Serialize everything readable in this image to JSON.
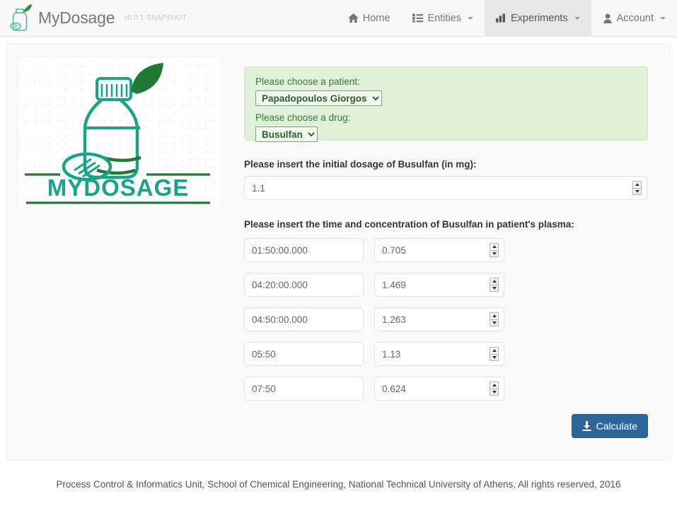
{
  "navbar": {
    "brand_name": "MyDosage",
    "brand_version": "v0.0.1-SNAPSHOT",
    "brand_icon": "medicine-bottle-icon",
    "items": [
      {
        "label": "Home",
        "icon": "home-icon",
        "active": false,
        "caret": false
      },
      {
        "label": "Entities",
        "icon": "list-icon",
        "active": false,
        "caret": true
      },
      {
        "label": "Experiments",
        "icon": "bar-chart-icon",
        "active": true,
        "caret": true
      },
      {
        "label": "Account",
        "icon": "user-icon",
        "active": false,
        "caret": true
      }
    ]
  },
  "logo": {
    "alt": "MyDosage logo",
    "wordmark": "MYDOSAGE",
    "teal": "#19A38A",
    "dark_green": "#1F7A34"
  },
  "selection_panel": {
    "patient_label": "Please choose a patient:",
    "patient_value": "Papadopoulos Giorgos",
    "drug_label": "Please choose a drug:",
    "drug_value": "Busulfan",
    "background": "#dff0d8",
    "text_color": "#3c763d"
  },
  "dosage": {
    "label": "Please insert the initial dosage of Busulfan (in mg):",
    "value": "1.1"
  },
  "measurements": {
    "label": "Please insert the time and concentration of Busulfan in patient's plasma:",
    "rows": [
      {
        "time": "01:50:00.000",
        "concentration": "0.705"
      },
      {
        "time": "04:20:00.000",
        "concentration": "1.469"
      },
      {
        "time": "04:50:00.000",
        "concentration": "1.263"
      },
      {
        "time": "05:50",
        "concentration": "1.13"
      },
      {
        "time": "07:50",
        "concentration": "0.624"
      }
    ]
  },
  "actions": {
    "calculate_label": "Calculate",
    "calculate_icon": "download-icon",
    "calculate_color": "#2b6699"
  },
  "footer": {
    "text": "Process Control & Informatics Unit, School of Chemical Engineering, National Technical University of Athens, All rights reserved, 2016"
  }
}
